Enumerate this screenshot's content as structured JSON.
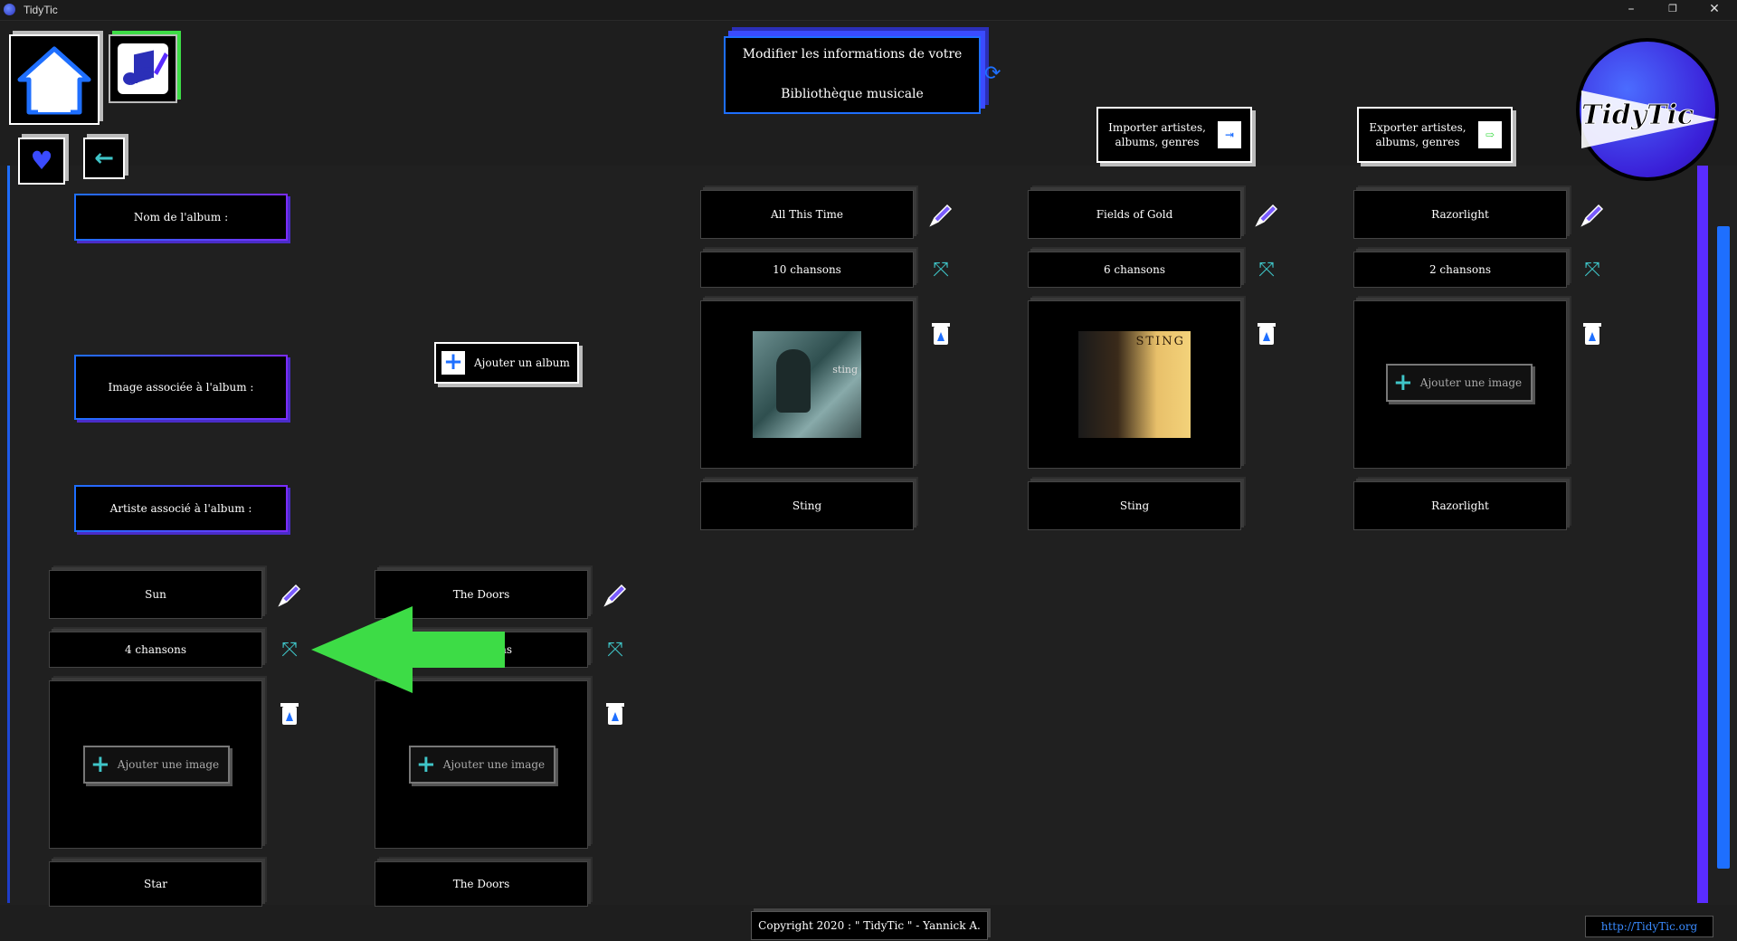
{
  "window": {
    "title": "TidyTic",
    "minimize": "–",
    "restore": "❐",
    "close": "✕"
  },
  "header": {
    "title_line1": "Modifier les informations de votre",
    "title_line2": "Bibliothèque musicale",
    "import_label": "Importer artistes, albums, genres",
    "export_label": "Exporter artistes, albums, genres",
    "logo_text": "TidyTic"
  },
  "form": {
    "album_name_label": "Nom de l'album :",
    "album_image_label": "Image associée à l'album :",
    "album_artist_label": "Artiste associé à l'album :",
    "add_album_label": "Ajouter un album"
  },
  "albums": [
    {
      "name": "All This Time",
      "songs": "10 chansons",
      "artist": "Sting",
      "has_image": true,
      "cover": "all-this-time"
    },
    {
      "name": "Fields of Gold",
      "songs": "6 chansons",
      "artist": "Sting",
      "has_image": true,
      "cover": "fields-of-gold"
    },
    {
      "name": "Razorlight",
      "songs": "2 chansons",
      "artist": "Razorlight",
      "has_image": false
    },
    {
      "name": "Sun",
      "songs": "4 chansons",
      "artist": "Star",
      "has_image": false
    },
    {
      "name": "The Doors",
      "songs": "4 chansons",
      "artist": "The Doors",
      "has_image": false
    }
  ],
  "add_image_label": "Ajouter une image",
  "cover_text": {
    "fields_of_gold": "STING",
    "all_this_time": "sting"
  },
  "footer": {
    "copyright": "Copyright 2020 : \" TidyTic \" - Yannick A.",
    "link": "http://TidyTic.org"
  },
  "colors": {
    "accent_blue": "#1e6fff",
    "accent_purple": "#5a2cff",
    "arrow_green": "#3ddc46"
  }
}
